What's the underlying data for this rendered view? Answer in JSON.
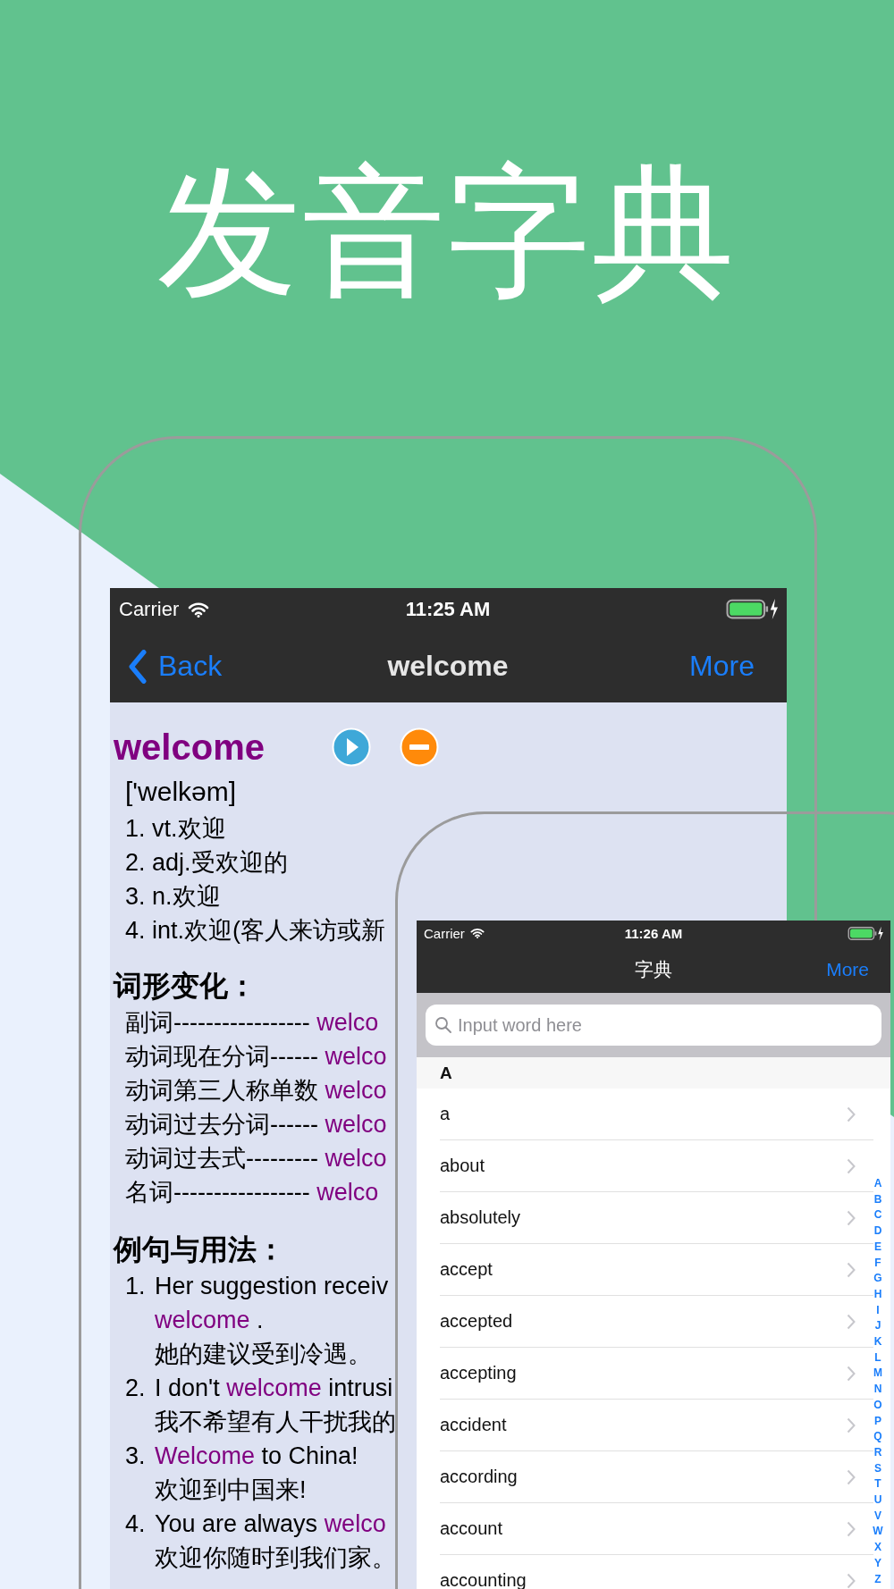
{
  "headline": "发音字典",
  "detail_screen": {
    "status_bar": {
      "carrier": "Carrier",
      "time": "11:25 AM"
    },
    "nav": {
      "back": "Back",
      "title": "welcome",
      "more": "More"
    },
    "word": "welcome",
    "phonetic": "['welkəm]",
    "definitions": [
      "1. vt.欢迎",
      "2. adj.受欢迎的",
      "3. n.欢迎",
      "4. int.欢迎(客人来访或新"
    ],
    "forms_heading": "词形变化：",
    "forms": [
      {
        "label": "副词-----------------",
        "value": "welco"
      },
      {
        "label": "动词现在分词------",
        "value": "welco"
      },
      {
        "label": "动词第三人称单数",
        "value": "welco"
      },
      {
        "label": "动词过去分词------",
        "value": "welco"
      },
      {
        "label": "动词过去式---------",
        "value": "welco"
      },
      {
        "label": "名词-----------------",
        "value": "welco"
      }
    ],
    "examples_heading": "例句与用法：",
    "examples": [
      {
        "number": "1.",
        "lines": [
          [
            {
              "text": "Her suggestion receiv",
              "highlight": false
            }
          ],
          [
            {
              "text": "welcome",
              "highlight": true
            },
            {
              "text": " .",
              "highlight": false
            }
          ],
          [
            {
              "text": "她的建议受到冷遇。",
              "highlight": false
            }
          ]
        ]
      },
      {
        "number": "2.",
        "lines": [
          [
            {
              "text": "I don't ",
              "highlight": false
            },
            {
              "text": "welcome",
              "highlight": true
            },
            {
              "text": " intrusi",
              "highlight": false
            }
          ],
          [
            {
              "text": "我不希望有人干扰我的",
              "highlight": false
            }
          ]
        ]
      },
      {
        "number": "3.",
        "lines": [
          [
            {
              "text": "Welcome",
              "highlight": true
            },
            {
              "text": " to China!",
              "highlight": false
            }
          ],
          [
            {
              "text": "欢迎到中国来!",
              "highlight": false
            }
          ]
        ]
      },
      {
        "number": "4.",
        "lines": [
          [
            {
              "text": "You are always ",
              "highlight": false
            },
            {
              "text": "welco",
              "highlight": true
            }
          ],
          [
            {
              "text": "欢迎你随时到我们家。",
              "highlight": false
            }
          ]
        ]
      }
    ]
  },
  "list_screen": {
    "status_bar": {
      "carrier": "Carrier",
      "time": "11:26 AM"
    },
    "nav": {
      "title": "字典",
      "more": "More"
    },
    "search": {
      "placeholder": "Input word here"
    },
    "section": "A",
    "rows": [
      "a",
      "about",
      "absolutely",
      "accept",
      "accepted",
      "accepting",
      "accident",
      "according",
      "account",
      "accounting"
    ],
    "index": [
      "A",
      "B",
      "C",
      "D",
      "E",
      "F",
      "G",
      "H",
      "I",
      "J",
      "K",
      "L",
      "M",
      "N",
      "O",
      "P",
      "Q",
      "R",
      "S",
      "T",
      "U",
      "V",
      "W",
      "X",
      "Y",
      "Z"
    ]
  }
}
